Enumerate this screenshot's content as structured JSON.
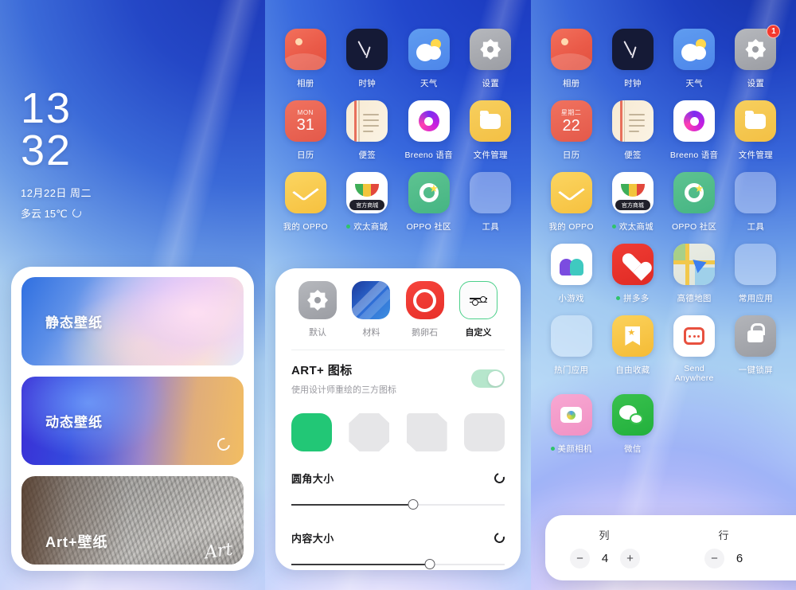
{
  "screen_left": {
    "clock": {
      "hours": "13",
      "minutes": "32",
      "date": "12月22日 周二",
      "weather": "多云 15℃",
      "refresh_icon": "refresh-icon"
    },
    "wallpaper_sheet": {
      "cards": [
        {
          "label": "静态壁纸",
          "type": "static"
        },
        {
          "label": "动态壁纸",
          "type": "live",
          "badge_icon": "live-wallpaper-icon"
        },
        {
          "label": "Art+壁纸",
          "type": "art",
          "signature": "Art"
        }
      ]
    }
  },
  "screen_mid": {
    "apps": [
      {
        "name": "相册",
        "icon": "photos-icon"
      },
      {
        "name": "时钟",
        "icon": "clock-icon"
      },
      {
        "name": "天气",
        "icon": "weather-icon"
      },
      {
        "name": "设置",
        "icon": "settings-icon"
      },
      {
        "name": "日历",
        "icon": "calendar-icon",
        "cal_weekday": "MON",
        "cal_day": "31"
      },
      {
        "name": "便签",
        "icon": "notes-icon"
      },
      {
        "name": "Breeno 语音",
        "icon": "breeno-voice-icon"
      },
      {
        "name": "文件管理",
        "icon": "file-manager-icon"
      },
      {
        "name": "我的 OPPO",
        "icon": "my-oppo-icon"
      },
      {
        "name": "欢太商城",
        "icon": "huantai-store-icon",
        "dot": true
      },
      {
        "name": "OPPO 社区",
        "icon": "oppo-community-icon"
      },
      {
        "name": "工具",
        "icon": "tools-folder-icon"
      }
    ],
    "settings_sheet": {
      "styles": [
        {
          "label": "默认",
          "selected": false
        },
        {
          "label": "材料",
          "selected": false
        },
        {
          "label": "鹅卵石",
          "selected": false
        },
        {
          "label": "自定义",
          "selected": true
        }
      ],
      "art_toggle": {
        "title": "ART+ 图标",
        "subtitle": "使用设计师重绘的三方图标",
        "state": "on",
        "accent_color": "#22c776"
      },
      "shape_swatches": [
        {
          "shape": "rounded-square",
          "selected": true,
          "color": "#22c776"
        },
        {
          "shape": "octagon",
          "selected": false,
          "color": "#e6e6e8"
        },
        {
          "shape": "cut-corner",
          "selected": false,
          "color": "#e6e6e8"
        },
        {
          "shape": "squircle",
          "selected": false,
          "color": "#e6e6e8"
        }
      ],
      "sliders": [
        {
          "label": "圆角大小",
          "value": 57,
          "reset_icon": "reset-icon"
        },
        {
          "label": "内容大小",
          "value": 65,
          "reset_icon": "reset-icon"
        }
      ]
    }
  },
  "screen_right": {
    "apps": [
      {
        "name": "相册",
        "icon": "photos-icon"
      },
      {
        "name": "时钟",
        "icon": "clock-icon"
      },
      {
        "name": "天气",
        "icon": "weather-icon"
      },
      {
        "name": "设置",
        "icon": "settings-icon",
        "badge": "1"
      },
      {
        "name": "日历",
        "icon": "calendar-icon",
        "cal_weekday": "星期二",
        "cal_day": "22"
      },
      {
        "name": "便签",
        "icon": "notes-icon"
      },
      {
        "name": "Breeno 语音",
        "icon": "breeno-voice-icon"
      },
      {
        "name": "文件管理",
        "icon": "file-manager-icon"
      },
      {
        "name": "我的 OPPO",
        "icon": "my-oppo-icon"
      },
      {
        "name": "欢太商城",
        "icon": "huantai-store-icon",
        "dot": true
      },
      {
        "name": "OPPO 社区",
        "icon": "oppo-community-icon"
      },
      {
        "name": "工具",
        "icon": "tools-folder-icon"
      },
      {
        "name": "小游戏",
        "icon": "mini-games-icon"
      },
      {
        "name": "拼多多",
        "icon": "pinduoduo-icon",
        "dot": true
      },
      {
        "name": "高德地图",
        "icon": "amap-icon"
      },
      {
        "name": "常用应用",
        "icon": "common-apps-folder-icon"
      },
      {
        "name": "热门应用",
        "icon": "hot-apps-folder-icon"
      },
      {
        "name": "自由收藏",
        "icon": "free-favorites-icon"
      },
      {
        "name": "Send Anywhere",
        "icon": "send-anywhere-icon"
      },
      {
        "name": "一键锁屏",
        "icon": "one-tap-lock-icon"
      },
      {
        "name": "美颜相机",
        "icon": "beauty-camera-icon",
        "dot": true
      },
      {
        "name": "微信",
        "icon": "wechat-icon"
      }
    ],
    "layout_sheet": {
      "columns": {
        "label": "列",
        "value": "4",
        "minus": "−",
        "plus": "+"
      },
      "rows": {
        "label": "行",
        "value": "6",
        "minus": "−",
        "plus": "+"
      }
    }
  }
}
